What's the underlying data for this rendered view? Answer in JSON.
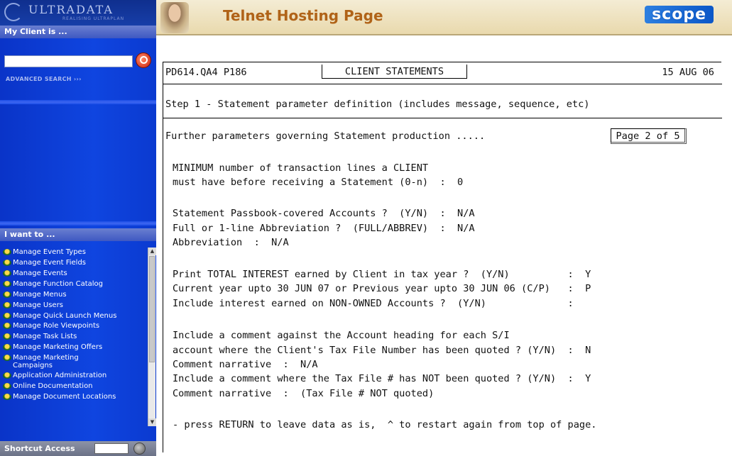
{
  "sidebar": {
    "logo_text": "ULTRADATA",
    "logo_tagline": "REALISING ULTRAPLAN",
    "client_header": "My Client is ...",
    "search_value": "",
    "advanced_search": "ADVANCED SEARCH",
    "advanced_search_arrows": "›››",
    "want_header": "I want to ...",
    "menu_items": [
      "Manage Event Types",
      "Manage Event Fields",
      "Manage Events",
      "Manage Function Catalog",
      "Manage Menus",
      "Manage Users",
      "Manage Quick Launch Menus",
      "Manage Role Viewpoints",
      "Manage Task Lists",
      "Manage Marketing Offers",
      "Manage Marketing Campaigns",
      "Application Administration",
      "Online Documentation",
      "Manage Document Locations"
    ],
    "shortcut_label": "Shortcut Access",
    "shortcut_value": ""
  },
  "header": {
    "title": "Telnet Hosting Page",
    "brand": "scope"
  },
  "terminal": {
    "screen_id": "PD614.QA4 P186",
    "screen_title": "CLIENT STATEMENTS",
    "date": "15 AUG 06",
    "step": "Step 1 - Statement parameter definition (includes message, sequence, etc)",
    "further": "Further parameters governing Statement production .....",
    "page_indicator": "Page 2 of 5",
    "lines": [
      "MINIMUM number of transaction lines a CLIENT",
      "must have before receiving a Statement (0-n)  :  0",
      "Statement Passbook-covered Accounts ?  (Y/N)  :  N/A",
      "Full or 1-line Abbreviation ?  (FULL/ABBREV)  :  N/A",
      "Abbreviation  :  N/A",
      "Print TOTAL INTEREST earned by Client in tax year ?  (Y/N)          :  Y",
      "Current year upto 30 JUN 07 or Previous year upto 30 JUN 06 (C/P)   :  P",
      "Include interest earned on NON-OWNED Accounts ?  (Y/N)              :",
      "Include a comment against the Account heading for each S/I",
      "account where the Client's Tax File Number has been quoted ? (Y/N)  :  N",
      "Comment narrative  :  N/A",
      "Include a comment where the Tax File # has NOT been quoted ? (Y/N)  :  Y",
      "Comment narrative  :  (Tax File # NOT quoted)",
      "- press RETURN to leave data as is,  ^ to restart again from top of page."
    ]
  }
}
